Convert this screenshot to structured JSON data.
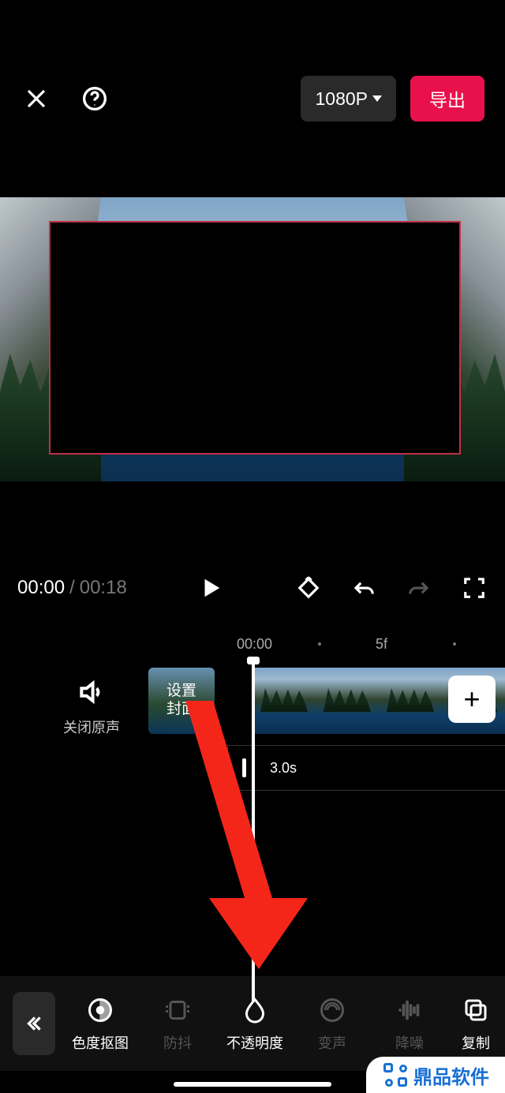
{
  "header": {
    "resolution": "1080P",
    "export_label": "导出"
  },
  "playback": {
    "current": "00:00",
    "separator": "/",
    "total": "00:18"
  },
  "ruler": {
    "t0": "00:00",
    "t1": "5f"
  },
  "tracks": {
    "mute_label": "关闭原声",
    "cover_label": "设置\n封面",
    "clip_duration": "3.0s",
    "add_symbol": "+"
  },
  "toolbar": {
    "items": [
      {
        "label": "色度抠图",
        "active": true
      },
      {
        "label": "防抖",
        "active": false
      },
      {
        "label": "不透明度",
        "active": true
      },
      {
        "label": "变声",
        "active": false
      },
      {
        "label": "降噪",
        "active": false
      },
      {
        "label": "复制",
        "active": true
      }
    ]
  },
  "watermark": "鼎品软件"
}
